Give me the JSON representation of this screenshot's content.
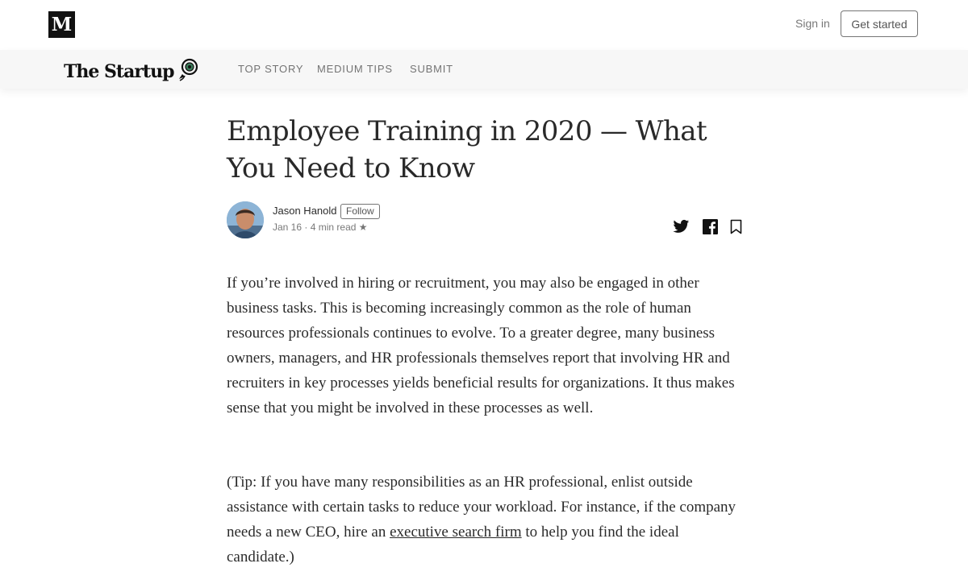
{
  "header": {
    "logo_letter": "M",
    "signin_label": "Sign in",
    "get_started_label": "Get started"
  },
  "publication": {
    "name": "The Startup",
    "nav": [
      "TOP STORY",
      "MEDIUM TIPS",
      "SUBMIT"
    ]
  },
  "article": {
    "title": "Employee Training in 2020 — What You Need to Know",
    "author": "Jason Hanold",
    "follow_label": "Follow",
    "date": "Jan 16",
    "read_time": "4 min read",
    "star": "★",
    "paragraph1": "If you’re involved in hiring or recruitment, you may also be engaged in other business tasks. This is becoming increasingly common as the role of human resources professionals continues to evolve. To a greater degree, many business owners, managers, and HR professionals themselves report that involving HR and recruiters in key processes yields beneficial results for organizations. It thus makes sense that you might be involved in these processes as well.",
    "paragraph2_before": "(Tip: If you have many responsibilities as an HR professional, enlist outside assistance with certain tasks to reduce your workload. For instance, if the company needs a new CEO, hire an ",
    "paragraph2_link": "executive search firm",
    "paragraph2_after": " to help you find the ideal candidate.)"
  },
  "icons": {
    "share": [
      "twitter-icon",
      "facebook-icon",
      "bookmark-icon"
    ]
  }
}
